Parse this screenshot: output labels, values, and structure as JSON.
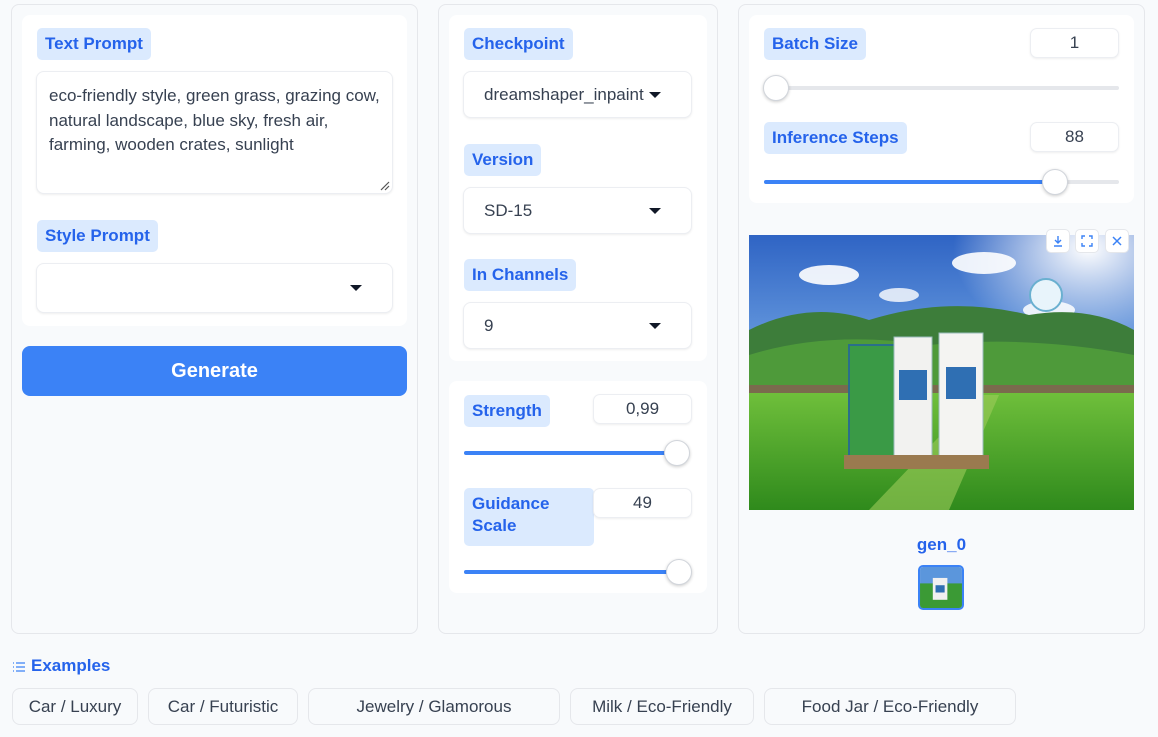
{
  "left_panel": {
    "text_prompt_label": "Text Prompt",
    "text_prompt_value": "eco-friendly style, green grass, grazing cow, natural landscape, blue sky, fresh air, farming, wooden crates, sunlight",
    "style_prompt_label": "Style Prompt",
    "style_prompt_value": "",
    "generate_label": "Generate"
  },
  "middle_panel": {
    "checkpoint_label": "Checkpoint",
    "checkpoint_value": "dreamshaper_inpaint",
    "version_label": "Version",
    "version_value": "SD-15",
    "in_channels_label": "In Channels",
    "in_channels_value": "9",
    "strength_label": "Strength",
    "strength_value": "0,99",
    "strength_fraction": 0.99,
    "guidance_label_line1": "Guidance",
    "guidance_label_line2": "Scale",
    "guidance_value": "49",
    "guidance_fraction": 1.0
  },
  "right_panel": {
    "batch_size_label": "Batch Size",
    "batch_size_value": "1",
    "batch_size_fraction": 0.0,
    "inference_steps_label": "Inference Steps",
    "inference_steps_value": "88",
    "inference_steps_fraction": 0.82,
    "image_icons": [
      "download-icon",
      "fullscreen-icon",
      "close-icon"
    ],
    "gallery_caption": "gen_0"
  },
  "examples": {
    "title": "Examples",
    "items": [
      "Car / Luxury",
      "Car / Futuristic",
      "Jewelry / Glamorous",
      "Milk / Eco-Friendly",
      "Food Jar / Eco-Friendly"
    ]
  },
  "colors": {
    "accent": "#3b82f6",
    "label_bg": "#dbeafe",
    "label_text": "#2563eb"
  }
}
